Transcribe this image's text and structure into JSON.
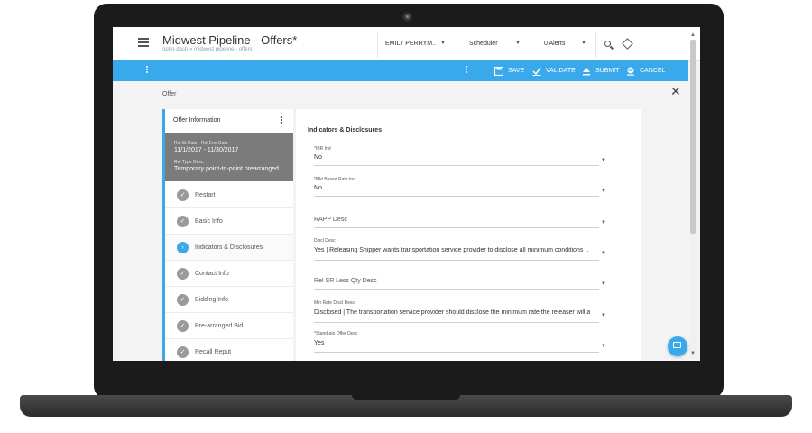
{
  "app": {
    "title": "Midwest Pipeline - Offers*",
    "breadcrumb": "optm-dash  »  midwest pipeline - offers"
  },
  "header": {
    "user": "EMILY PERRYM..",
    "scheduler": "Scheduler",
    "alerts": "0 Alerts"
  },
  "toolbar": {
    "save": "SAVE",
    "validate": "VALIDATE",
    "submit": "SUBMIT",
    "cancel": "CANCEL"
  },
  "page": {
    "label": "Offer",
    "close": "✕"
  },
  "sidebar": {
    "header": "Offer Information",
    "info": {
      "date_label": "Rel St Date - Rel End Date",
      "date_value": "11/1/2017 - 11/30/2017",
      "type_label": "Rel Type Desc",
      "type_value": "Temporary point-to-point prearranged"
    },
    "steps": [
      {
        "label": "Restart",
        "icon": "check-icon"
      },
      {
        "label": "Basic Info",
        "icon": "check-icon"
      },
      {
        "label": "Indicators & Disclosures",
        "icon": "chevron-right-icon"
      },
      {
        "label": "Contact Info",
        "icon": "check-icon"
      },
      {
        "label": "Bidding Info",
        "icon": "check-icon"
      },
      {
        "label": "Pre-arranged Bid",
        "icon": "check-icon"
      },
      {
        "label": "Recall Reput",
        "icon": "check-icon"
      }
    ]
  },
  "form": {
    "title": "Indicators & Disclosures",
    "fields": [
      {
        "label": "*IBR Ind",
        "value": "No"
      },
      {
        "label": "*Mkt Based Rate Ind",
        "value": "No"
      },
      {
        "label": "",
        "value": "RAPP Desc"
      },
      {
        "label": "Discl Desc",
        "value": "Yes | Releasing Shipper wants transportation service provider to disclose all minimum conditions .."
      },
      {
        "label": "",
        "value": "Rel SR Less Qty Desc"
      },
      {
        "label": "Min Rate Discl Desc",
        "value": "Disclosed | The transportation service provider should disclose the minimum rate the releaser will a"
      },
      {
        "label": "*Stand-alo Offer Desc",
        "value": "Yes"
      }
    ]
  },
  "colors": {
    "accent": "#3aa9ec",
    "info_panel": "#7b7b7b",
    "bezel": "#1b1b1b"
  }
}
